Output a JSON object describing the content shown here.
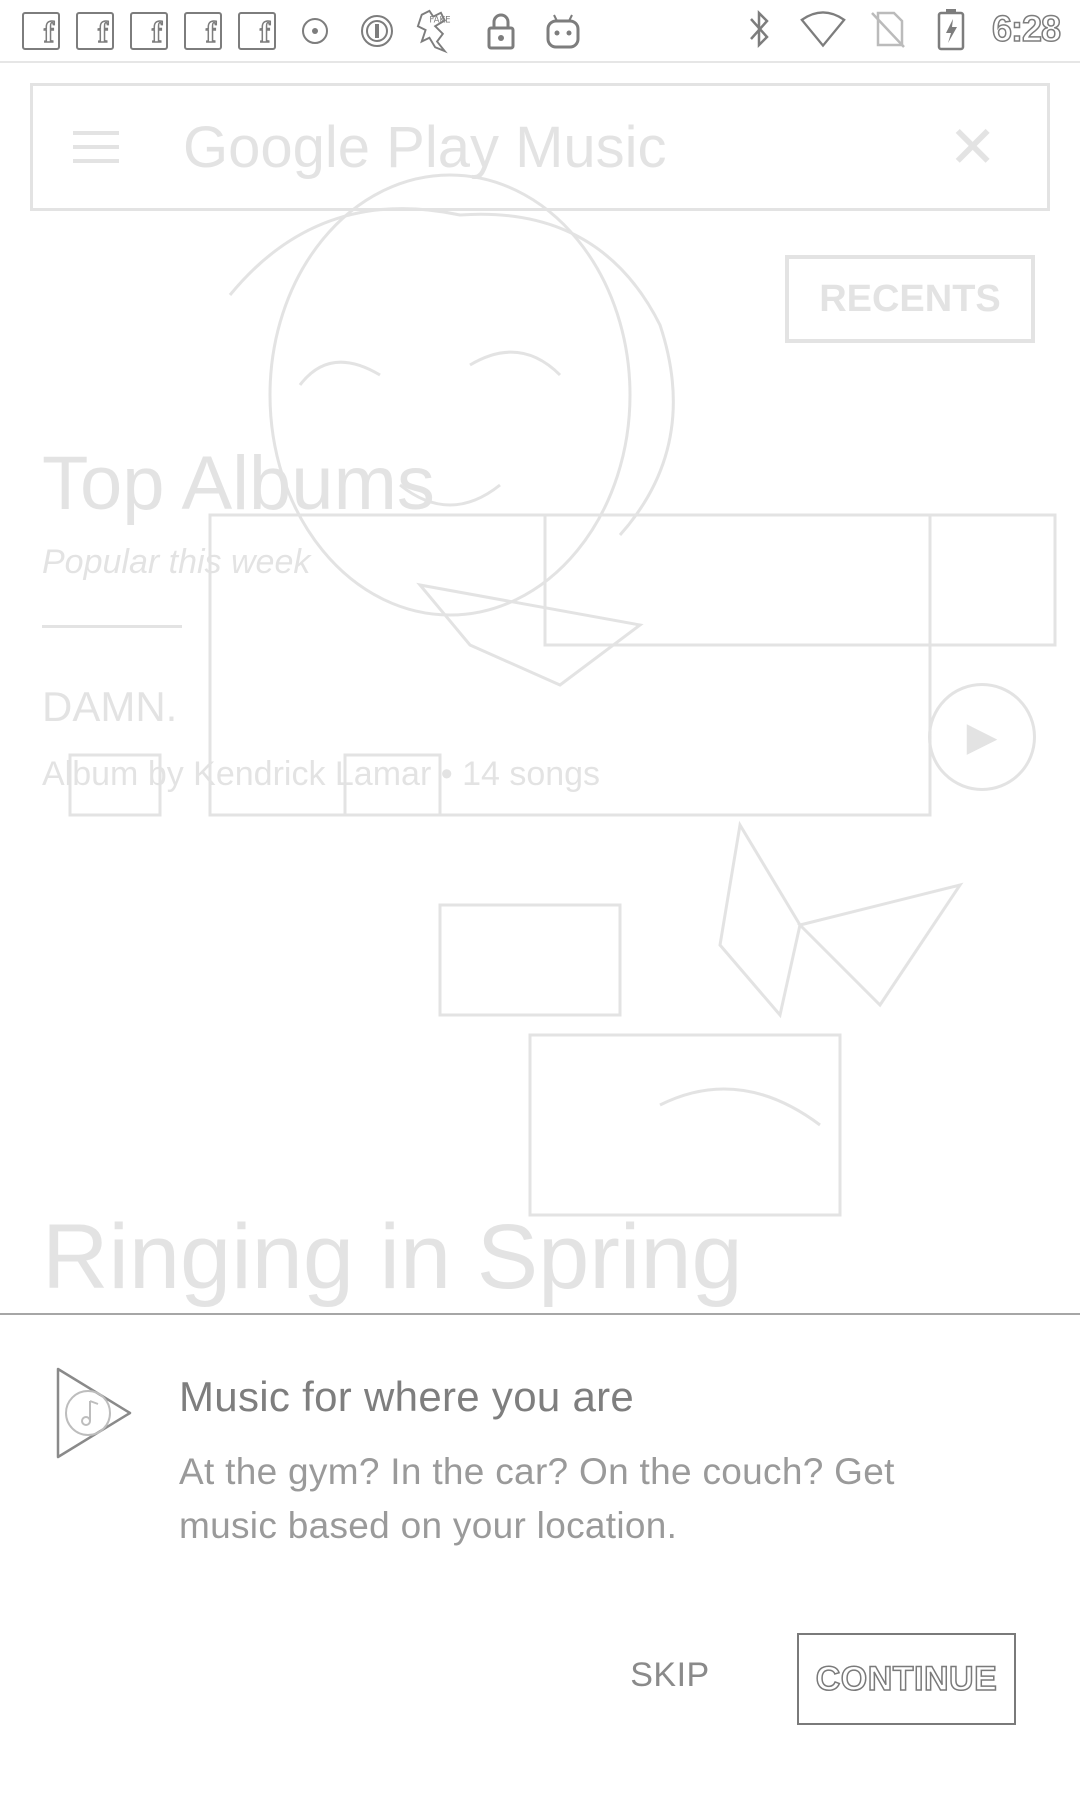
{
  "status_bar": {
    "left_icons": [
      {
        "icon": "facebook-icon",
        "glyph": "f"
      },
      {
        "icon": "facebook-icon",
        "glyph": "f"
      },
      {
        "icon": "facebook-icon",
        "glyph": "f"
      },
      {
        "icon": "facebook-icon",
        "glyph": "f"
      },
      {
        "icon": "facebook-icon",
        "glyph": "f"
      },
      {
        "icon": "record-dot-icon"
      },
      {
        "icon": "circle-i-icon"
      },
      {
        "icon": "fake-gps-icon"
      },
      {
        "icon": "lock-icon"
      },
      {
        "icon": "android-bot-icon"
      }
    ],
    "right_icons": [
      "bluetooth-icon",
      "wifi-icon",
      "no-sim-icon",
      "battery-charging-icon"
    ],
    "time": "6:28"
  },
  "background": {
    "app_title": "Google Play Music",
    "recents_label": "RECENTS",
    "section_title": "Top Albums",
    "section_subtitle": "Popular this week",
    "album_title": "DAMN.",
    "album_subtitle": "Album by Kendrick Lamar • 14 songs",
    "section_title_2": "Ringing in Spring"
  },
  "sheet": {
    "logo_icon": "play-music-logo-icon",
    "title": "Music for where you are",
    "body": "At the gym? In the car? On the couch? Get music based on your location.",
    "skip_label": "SKIP",
    "continue_label": "CONTINUE"
  },
  "colors": {
    "text_title": "#7e7e7e",
    "text_body": "#9a9a9a",
    "border": "#a6a6a6"
  }
}
